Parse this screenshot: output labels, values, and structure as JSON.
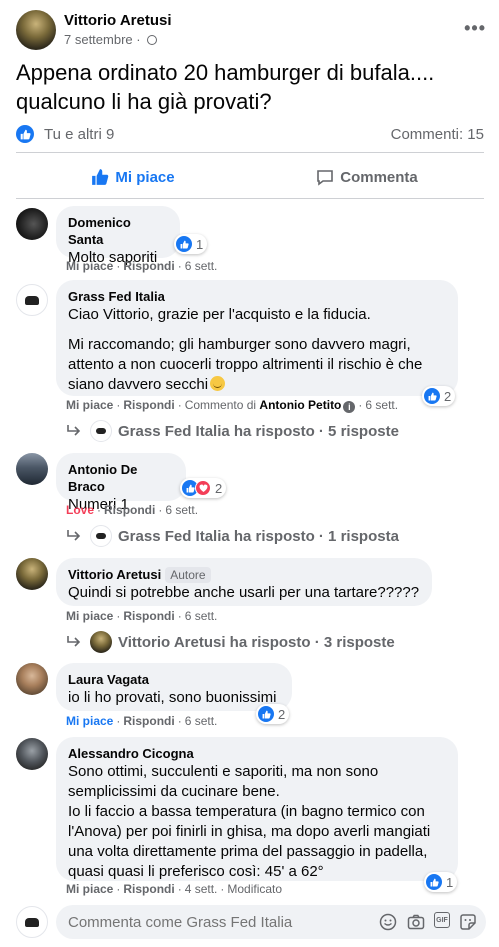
{
  "post": {
    "author": "Vittorio Aretusi",
    "date": "7 settembre",
    "more": "•••",
    "text": "Appena ordinato 20 hamburger di bufala.... qualcuno li ha già provati?",
    "reactors": "Tu e altri 9",
    "comments_count": "Commenti: 15"
  },
  "actions": {
    "like": "Mi piace",
    "comment": "Commenta"
  },
  "comments": [
    {
      "name": "Domenico Santa",
      "text": "Molto saporiti",
      "reaction_count": "1",
      "like": "Mi piace",
      "reply": "Rispondi",
      "time": "6 sett."
    },
    {
      "name": "Grass Fed Italia",
      "text1": "Ciao Vittorio, grazie per l'acquisto e la fiducia.",
      "text2": "Mi raccomando; gli hamburger sono davvero magri, attento a non cuocerli troppo altrimenti il rischio è che siano davvero secchi",
      "reaction_count": "2",
      "like": "Mi piace",
      "reply": "Rispondi",
      "comment_by_prefix": "Commento di",
      "comment_by_name": "Antonio Petito",
      "time": "6 sett.",
      "replies": "Grass Fed Italia ha risposto · 5 risposte"
    },
    {
      "name": "Antonio De Braco",
      "text": "Numeri 1",
      "reaction_count": "2",
      "like": "Love",
      "reply": "Rispondi",
      "time": "6 sett.",
      "replies": "Grass Fed Italia ha risposto · 1 risposta"
    },
    {
      "name": "Vittorio Aretusi",
      "badge": "Autore",
      "text": "Quindi si potrebbe anche usarli per una tartare?????",
      "like": "Mi piace",
      "reply": "Rispondi",
      "time": "6 sett.",
      "replies": "Vittorio Aretusi ha risposto · 3 risposte"
    },
    {
      "name": "Laura Vagata",
      "text": "io li ho provati, sono buonissimi",
      "reaction_count": "2",
      "like": "Mi piace",
      "reply": "Rispondi",
      "time": "6 sett."
    },
    {
      "name": "Alessandro Cicogna",
      "line1": "Sono ottimi, succulenti e saporiti, ma non sono",
      "line2": "semplicissimi da cucinare bene.",
      "line3": "Io li faccio a bassa temperatura (in bagno termico con",
      "line4": "l'Anova) per poi finirli in ghisa, ma dopo averli mangiati",
      "line5": "una volta direttamente prima del passaggio in padella,",
      "line6": "quasi quasi li preferisco così: 45' a 62°",
      "reaction_count": "1",
      "like": "Mi piace",
      "reply": "Rispondi",
      "time": "4 sett.",
      "edited": "Modificato"
    }
  ],
  "composer": {
    "placeholder": "Commenta come Grass Fed Italia"
  },
  "colors": {
    "accent": "#1877f2",
    "love": "#f33e58",
    "bubble": "#f0f2f5",
    "muted": "#65676b"
  }
}
